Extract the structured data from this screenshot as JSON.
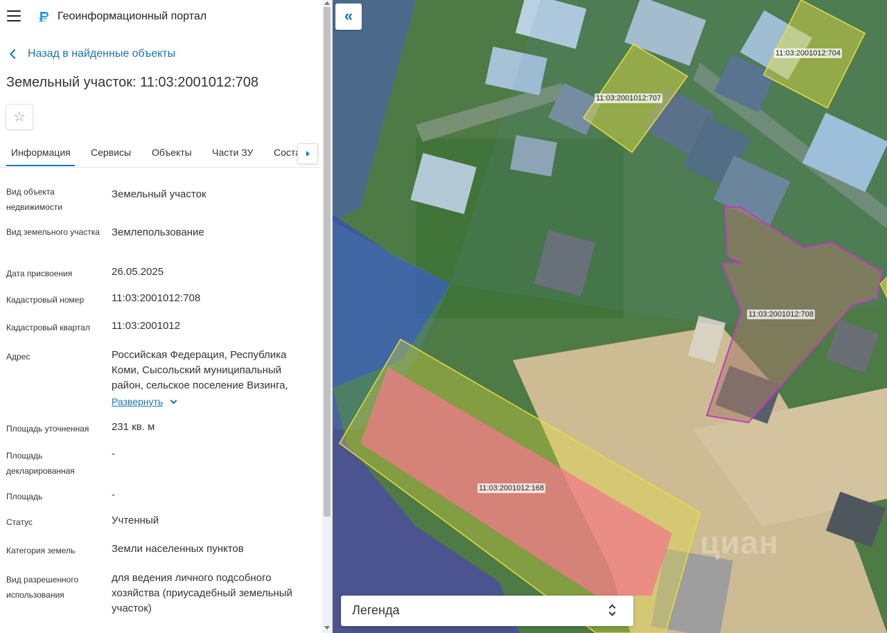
{
  "header": {
    "menu_icon": "hamburger-icon",
    "logo_icon": "portal-logo-icon",
    "title": "Геоинформационный портал"
  },
  "nav": {
    "back_label": "Назад в найденные объекты"
  },
  "object": {
    "title": "Земельный участок: 11:03:2001012:708"
  },
  "favorite_icon": "star-icon",
  "tabs": [
    {
      "label": "Информация",
      "active": true
    },
    {
      "label": "Сервисы"
    },
    {
      "label": "Объекты"
    },
    {
      "label": "Части ЗУ"
    },
    {
      "label": "Соста"
    }
  ],
  "properties": [
    {
      "label": "Вид объекта недвижимости",
      "value": "Земельный участок"
    },
    {
      "label": "Вид земельного участка",
      "value": "Землепользование"
    },
    {
      "label": "Дата присвоения",
      "value": "26.05.2025"
    },
    {
      "label": "Кадастровый номер",
      "value": "11:03:2001012:708"
    },
    {
      "label": "Кадастровый квартал",
      "value": "11:03:2001012"
    },
    {
      "label": "Адрес",
      "value": "Российская Федерация, Республика Коми, Сысольский муниципальный район, сельское поселение Визинга,",
      "expand_label": "Развернуть"
    },
    {
      "label": "Площадь уточненная",
      "value": "231 кв. м"
    },
    {
      "label": "Площадь декларированная",
      "value": "-"
    },
    {
      "label": "Площадь",
      "value": "-"
    },
    {
      "label": "Статус",
      "value": "Учтенный"
    },
    {
      "label": "Категория земель",
      "value": "Земли населенных пунктов"
    },
    {
      "label": "Вид разрешенного использования",
      "value": "для ведения личного подсобного хозяйства (приусадебный земельный участок)"
    }
  ],
  "map": {
    "collapse_label": "«",
    "parcels": [
      {
        "label": "11:03:2001012:707"
      },
      {
        "label": "11:03:2001012:704"
      },
      {
        "label": "11:03:2001012:708"
      },
      {
        "label": "11:03:2001012:168"
      }
    ],
    "legend_label": "Легенда",
    "watermark": "циан",
    "colors": {
      "selected_outline": "#c03bc0",
      "parcel_outline": "#e8e040",
      "highlight_fill": "#f07a8a",
      "zone_fill": "#3a4ad8"
    }
  }
}
